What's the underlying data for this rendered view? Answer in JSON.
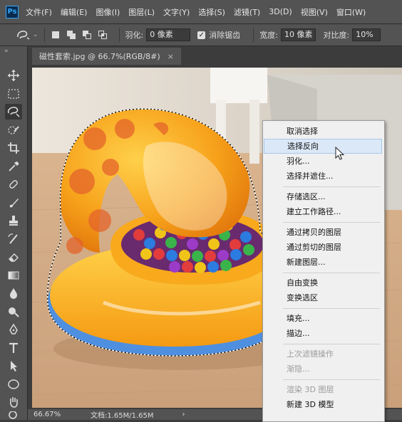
{
  "menubar": {
    "logo": "Ps",
    "items": [
      "文件(F)",
      "编辑(E)",
      "图像(I)",
      "图层(L)",
      "文字(Y)",
      "选择(S)",
      "滤镜(T)",
      "3D(D)",
      "视图(V)",
      "窗口(W)"
    ]
  },
  "options": {
    "feather_label": "羽化:",
    "feather_value": "0 像素",
    "antialias_label": "消除锯齿",
    "width_label": "宽度:",
    "width_value": "10 像素",
    "contrast_label": "对比度:",
    "contrast_value": "10%"
  },
  "document": {
    "tab_title": "磁性套索.jpg @ 66.7%(RGB/8#)",
    "close_glyph": "×"
  },
  "status": {
    "zoom": "66.67%",
    "doc_info": "文档:1.65M/1.65M",
    "arrow": "›"
  },
  "context_menu": {
    "items": [
      {
        "label": "取消选择",
        "enabled": true
      },
      {
        "label": "选择反向",
        "enabled": true,
        "hover": true
      },
      {
        "label": "羽化...",
        "enabled": true
      },
      {
        "label": "选择并遮住...",
        "enabled": true
      },
      {
        "label": "存储选区...",
        "enabled": true
      },
      {
        "label": "建立工作路径...",
        "enabled": true
      },
      {
        "label": "通过拷贝的图层",
        "enabled": true
      },
      {
        "label": "通过剪切的图层",
        "enabled": true
      },
      {
        "label": "新建图层...",
        "enabled": true
      },
      {
        "label": "自由变换",
        "enabled": true
      },
      {
        "label": "变换选区",
        "enabled": true
      },
      {
        "label": "填充...",
        "enabled": true
      },
      {
        "label": "描边...",
        "enabled": true
      },
      {
        "label": "上次滤镜操作",
        "enabled": false
      },
      {
        "label": "渐隐...",
        "enabled": false
      },
      {
        "label": "渲染 3D 图层",
        "enabled": false
      },
      {
        "label": "新建 3D 模型",
        "enabled": true
      }
    ]
  },
  "tools": [
    "move-tool-icon",
    "marquee-tool-icon",
    "magnetic-lasso-tool-icon",
    "quick-selection-tool-icon",
    "crop-tool-icon",
    "eyedropper-tool-icon",
    "healing-brush-tool-icon",
    "brush-tool-icon",
    "clone-stamp-tool-icon",
    "history-brush-tool-icon",
    "eraser-tool-icon",
    "gradient-tool-icon",
    "blur-tool-icon",
    "dodge-tool-icon",
    "pen-tool-icon",
    "type-tool-icon",
    "path-selection-tool-icon",
    "ellipse-tool-icon",
    "hand-tool-icon",
    "zoom-tool-icon"
  ],
  "colors": {
    "ui_dark": "#535353",
    "menu_bg": "#f0f0f0",
    "menu_hover": "#dbe8f7",
    "pool_orange": "#f7a21b",
    "floor": "#d9b48f"
  }
}
